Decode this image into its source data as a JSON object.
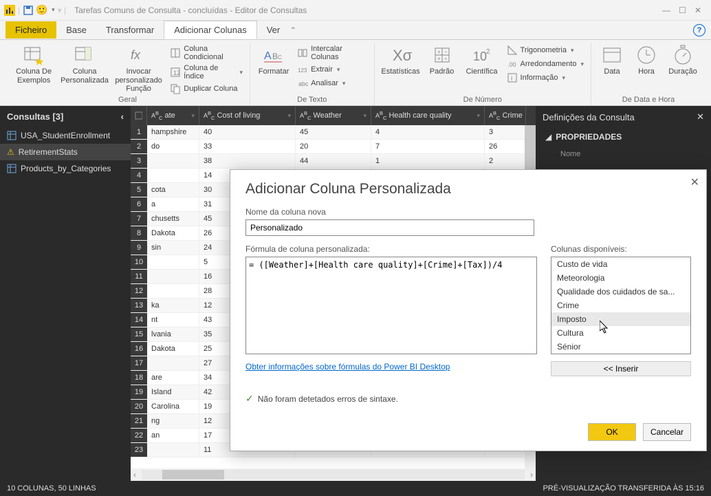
{
  "window": {
    "title": "Tarefas Comuns de Consulta - concluídas - Editor de Consultas"
  },
  "tabs": {
    "file": "Ficheiro",
    "home": "Base",
    "transform": "Transformar",
    "addcol": "Adicionar Colunas",
    "view": "Ver"
  },
  "ribbon": {
    "col_from_examples": "Coluna De Exemplos",
    "custom_column": "Coluna Personalizada",
    "invoke_fn": "Invocar personalizado Função",
    "cond_column": "Coluna Condicional",
    "index_column": "Coluna de Índice",
    "dup_column": "Duplicar Coluna",
    "g_general": "Geral",
    "format": "Formatar",
    "merge_cols": "Intercalar Colunas",
    "extract": "Extrair",
    "parse": "Analisar",
    "g_text": "De Texto",
    "stats": "Estatísticas",
    "standard": "Padrão",
    "scientific": "Científica",
    "trig": "Trigonometria",
    "rounding": "Arredondamento",
    "info": "Informação",
    "g_number": "De Número",
    "date": "Data",
    "time": "Hora",
    "duration": "Duração",
    "g_datetime": "De Data e Hora"
  },
  "queries": {
    "header": "Consultas [3]",
    "items": [
      "USA_StudentEnrollment",
      "RetirementStats",
      "Products_by_Categories"
    ]
  },
  "columns": [
    "ate",
    "Cost of living",
    "Weather",
    "Health care quality",
    "Crime"
  ],
  "rows": [
    {
      "n": 1,
      "state": "hampshire",
      "cost": "40",
      "weather": "45",
      "health": "4",
      "crime": "3"
    },
    {
      "n": 2,
      "state": "do",
      "cost": "33",
      "weather": "20",
      "health": "7",
      "crime": "26"
    },
    {
      "n": 3,
      "state": "",
      "cost": "38",
      "weather": "44",
      "health": "1",
      "crime": "2"
    },
    {
      "n": 4,
      "state": "",
      "cost": "14",
      "weather": "",
      "health": "",
      "crime": ""
    },
    {
      "n": 5,
      "state": "cota",
      "cost": "30",
      "weather": "",
      "health": "",
      "crime": ""
    },
    {
      "n": 6,
      "state": "a",
      "cost": "31",
      "weather": "",
      "health": "",
      "crime": ""
    },
    {
      "n": 7,
      "state": "chusetts",
      "cost": "45",
      "weather": "",
      "health": "",
      "crime": ""
    },
    {
      "n": 8,
      "state": "Dakota",
      "cost": "26",
      "weather": "",
      "health": "",
      "crime": ""
    },
    {
      "n": 9,
      "state": "sin",
      "cost": "24",
      "weather": "",
      "health": "",
      "crime": ""
    },
    {
      "n": 10,
      "state": "",
      "cost": "5",
      "weather": "",
      "health": "",
      "crime": ""
    },
    {
      "n": 11,
      "state": "",
      "cost": "16",
      "weather": "",
      "health": "",
      "crime": ""
    },
    {
      "n": 12,
      "state": "",
      "cost": "28",
      "weather": "",
      "health": "",
      "crime": ""
    },
    {
      "n": 13,
      "state": "ka",
      "cost": "12",
      "weather": "",
      "health": "",
      "crime": ""
    },
    {
      "n": 14,
      "state": "nt",
      "cost": "43",
      "weather": "",
      "health": "",
      "crime": ""
    },
    {
      "n": 15,
      "state": "lvania",
      "cost": "35",
      "weather": "",
      "health": "",
      "crime": ""
    },
    {
      "n": 16,
      "state": "Dakota",
      "cost": "25",
      "weather": "",
      "health": "",
      "crime": ""
    },
    {
      "n": 17,
      "state": "",
      "cost": "27",
      "weather": "",
      "health": "",
      "crime": ""
    },
    {
      "n": 18,
      "state": "are",
      "cost": "34",
      "weather": "",
      "health": "",
      "crime": ""
    },
    {
      "n": 19,
      "state": "Island",
      "cost": "42",
      "weather": "",
      "health": "",
      "crime": ""
    },
    {
      "n": 20,
      "state": "Carolina",
      "cost": "19",
      "weather": "",
      "health": "",
      "crime": ""
    },
    {
      "n": 21,
      "state": "ng",
      "cost": "12",
      "weather": "",
      "health": "",
      "crime": ""
    },
    {
      "n": 22,
      "state": "an",
      "cost": "17",
      "weather": "",
      "health": "",
      "crime": ""
    },
    {
      "n": 23,
      "state": "",
      "cost": "11",
      "weather": "",
      "health": "",
      "crime": ""
    }
  ],
  "settings": {
    "header": "Definições da Consulta",
    "properties": "PROPRIEDADES",
    "name_lbl": "Nome"
  },
  "dialog": {
    "title": "Adicionar Coluna Personalizada",
    "new_col_lbl": "Nome da coluna nova",
    "new_col_val": "Personalizado",
    "formula_lbl": "Fórmula de coluna personalizada:",
    "formula_val": "= ([Weather]+[Health care quality]+[Crime]+[Tax])/4",
    "avail_lbl": "Colunas disponíveis:",
    "avail_items": [
      "Custo de vida",
      "Meteorologia",
      "Qualidade dos cuidados de sa...",
      "Crime",
      "Imposto",
      "Cultura",
      "Sénior"
    ],
    "insert": "<< Inserir",
    "learn": "Obter informações sobre fórmulas do Power BI Desktop",
    "syntax": "Não foram detetados erros de sintaxe.",
    "ok": "OK",
    "cancel": "Cancelar"
  },
  "status": {
    "left": "10 COLUNAS, 50 LINHAS",
    "right": "PRÉ-VISUALIZAÇÃO TRANSFERIDA ÀS 15:16"
  }
}
